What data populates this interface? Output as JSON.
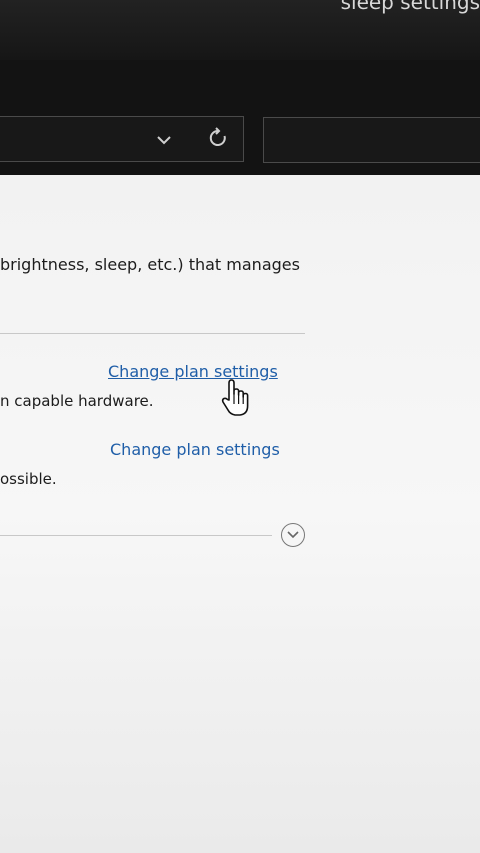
{
  "window": {
    "title": "sleep settings"
  },
  "description": "brightness, sleep, etc.) that manages",
  "plans": [
    {
      "link": "Change plan settings",
      "desc": "n capable hardware."
    },
    {
      "link": "Change plan settings",
      "desc": "ossible."
    }
  ],
  "colors": {
    "link": "#1f5ea8",
    "titlebar": "#1a1a1a",
    "content_bg": "#f6f6f6"
  }
}
